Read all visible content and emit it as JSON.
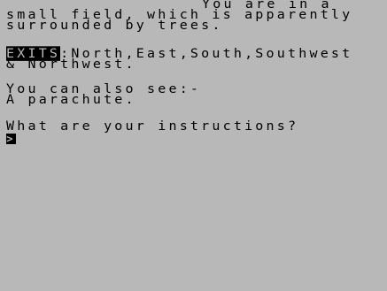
{
  "description": {
    "line1": "You are in a",
    "line2": "small field, which is apparently",
    "line3": "surrounded by trees."
  },
  "exits": {
    "label": "EXITS",
    "line1_rest": ":North,East,South,Southwest",
    "line2": "& Northwest."
  },
  "objects": {
    "heading": "You can also see:-",
    "item1": "A parachute."
  },
  "prompt": {
    "question": "What are your instructions?",
    "cursor": ">"
  },
  "colors": {
    "background": "#b8b8b8",
    "text": "#000000"
  }
}
